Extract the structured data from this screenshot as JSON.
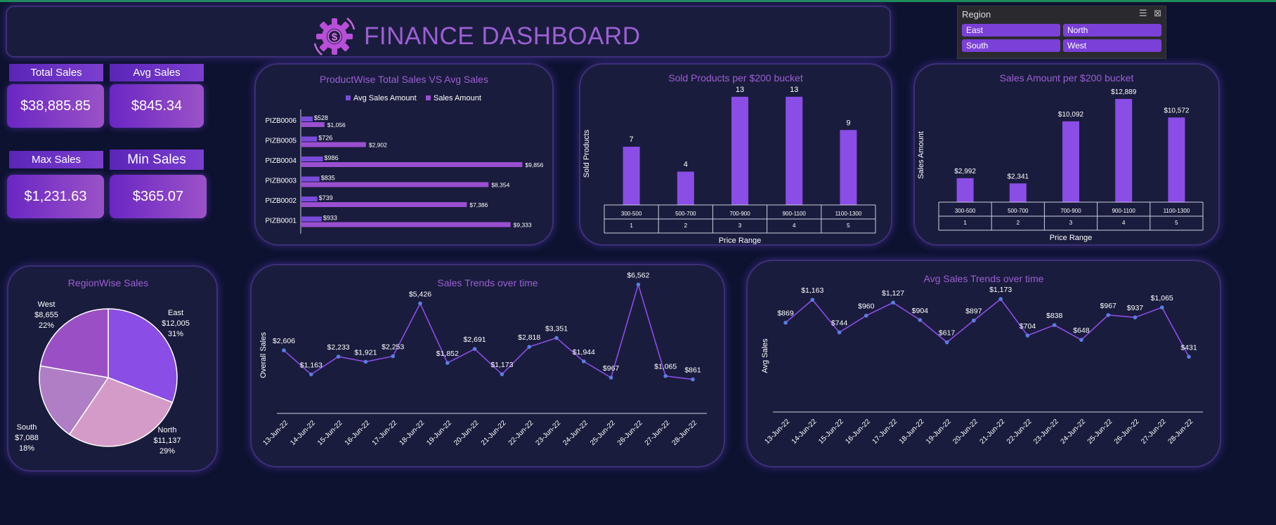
{
  "header": {
    "title": "FINANCE DASHBOARD"
  },
  "kpis": {
    "total_sales": {
      "label": "Total Sales",
      "value": "$38,885.85"
    },
    "avg_sales": {
      "label": "Avg Sales",
      "value": "$845.34"
    },
    "max_sales": {
      "label": "Max Sales",
      "value": "$1,231.63"
    },
    "min_sales": {
      "label": "Min Sales",
      "value": "$365.07"
    }
  },
  "slicer": {
    "title": "Region",
    "items": [
      "East",
      "North",
      "South",
      "West"
    ]
  },
  "colors": {
    "accent": "#8a4de6",
    "series_avg": "#7a4bdb",
    "series_sales": "#9a4fd0",
    "title": "#9b5fd4"
  },
  "chart_data": [
    {
      "id": "productwise",
      "type": "bar",
      "orientation": "horizontal",
      "title": "ProductWise Total Sales VS Avg Sales",
      "categories": [
        "PIZB0006",
        "PIZB0005",
        "PIZB0004",
        "PIZB0003",
        "PIZB0002",
        "PIZB0001"
      ],
      "series": [
        {
          "name": "Avg Sales Amount",
          "values": [
            528,
            726,
            986,
            835,
            739,
            933
          ],
          "labels": [
            "$528",
            "$726",
            "$986",
            "$835",
            "$739",
            "$933"
          ]
        },
        {
          "name": "Sales Amount",
          "values": [
            1056,
            2902,
            9856,
            8354,
            7386,
            9333
          ],
          "labels": [
            "$1,056",
            "$2,902",
            "$9,856",
            "$8,354",
            "$7,386",
            "$9,333"
          ]
        }
      ],
      "legend": "top",
      "xlim": [
        0,
        10000
      ]
    },
    {
      "id": "sold_products",
      "type": "bar",
      "title": "Sold Products per $200 bucket",
      "categories": [
        "300-500",
        "500-700",
        "700-900",
        "900-1100",
        "1100-1300"
      ],
      "subcategories": [
        "1",
        "2",
        "3",
        "4",
        "5"
      ],
      "values": [
        7,
        4,
        13,
        13,
        9
      ],
      "labels": [
        "7",
        "4",
        "13",
        "13",
        "9"
      ],
      "xlabel": "Price Range",
      "ylabel": "Sold Products",
      "ylim": [
        0,
        14
      ]
    },
    {
      "id": "sales_amount_bucket",
      "type": "bar",
      "title": "Sales Amount per $200 bucket",
      "categories": [
        "300-500",
        "500-700",
        "700-900",
        "900-1100",
        "1100-1300"
      ],
      "subcategories": [
        "1",
        "2",
        "3",
        "4",
        "5"
      ],
      "values": [
        2992,
        2341,
        10092,
        12889,
        10572
      ],
      "labels": [
        "$2,992",
        "$2,341",
        "$10,092",
        "$12,889",
        "$10,572"
      ],
      "xlabel": "Price Range",
      "ylabel": "Sales Amount",
      "ylim": [
        0,
        13500
      ]
    },
    {
      "id": "regionwise",
      "type": "pie",
      "title": "RegionWise Sales",
      "slices": [
        {
          "name": "East",
          "value": 12005,
          "label": "$12,005",
          "pct": "31%",
          "color": "#8a4de6"
        },
        {
          "name": "North",
          "value": 11137,
          "label": "$11,137",
          "pct": "29%",
          "color": "#d49bc8"
        },
        {
          "name": "South",
          "value": 7088,
          "label": "$7,088",
          "pct": "18%",
          "color": "#b07ec4"
        },
        {
          "name": "West",
          "value": 8655,
          "label": "$8,655",
          "pct": "22%",
          "color": "#9a50c4"
        }
      ]
    },
    {
      "id": "sales_trend",
      "type": "line",
      "title": "Sales Trends over time",
      "ylabel": "Overall Sales",
      "x": [
        "13-Jun-22",
        "14-Jun-22",
        "15-Jun-22",
        "16-Jun-22",
        "17-Jun-22",
        "18-Jun-22",
        "19-Jun-22",
        "20-Jun-22",
        "21-Jun-22",
        "22-Jun-22",
        "23-Jun-22",
        "24-Jun-22",
        "25-Jun-22",
        "26-Jun-22",
        "27-Jun-22",
        "28-Jun-22"
      ],
      "values": [
        2606,
        1163,
        2233,
        1921,
        2253,
        5426,
        1852,
        2691,
        1173,
        2818,
        3351,
        1944,
        967,
        6562,
        1065,
        861
      ],
      "labels": [
        "$2,606",
        "$1,163",
        "$2,233",
        "$1,921",
        "$2,253",
        "$5,426",
        "$1,852",
        "$2,691",
        "$1,173",
        "$2,818",
        "$3,351",
        "$1,944",
        "$967",
        "$6,562",
        "$1,065",
        "$861"
      ],
      "ylim": [
        0,
        7000
      ]
    },
    {
      "id": "avg_trend",
      "type": "line",
      "title": "Avg Sales Trends over time",
      "ylabel": "Avg Sales",
      "x": [
        "13-Jun-22",
        "14-Jun-22",
        "15-Jun-22",
        "16-Jun-22",
        "17-Jun-22",
        "18-Jun-22",
        "19-Jun-22",
        "20-Jun-22",
        "21-Jun-22",
        "22-Jun-22",
        "23-Jun-22",
        "24-Jun-22",
        "25-Jun-22",
        "26-Jun-22",
        "27-Jun-22",
        "28-Jun-22"
      ],
      "values": [
        869,
        1163,
        744,
        960,
        1127,
        904,
        617,
        897,
        1173,
        704,
        838,
        648,
        967,
        937,
        1065,
        431
      ],
      "labels": [
        "$869",
        "$1,163",
        "$744",
        "$960",
        "$1,127",
        "$904",
        "$617",
        "$897",
        "$1,173",
        "$704",
        "$838",
        "$648",
        "$967",
        "$937",
        "$1,065",
        "$431"
      ],
      "ylim": [
        0,
        1300
      ]
    }
  ]
}
